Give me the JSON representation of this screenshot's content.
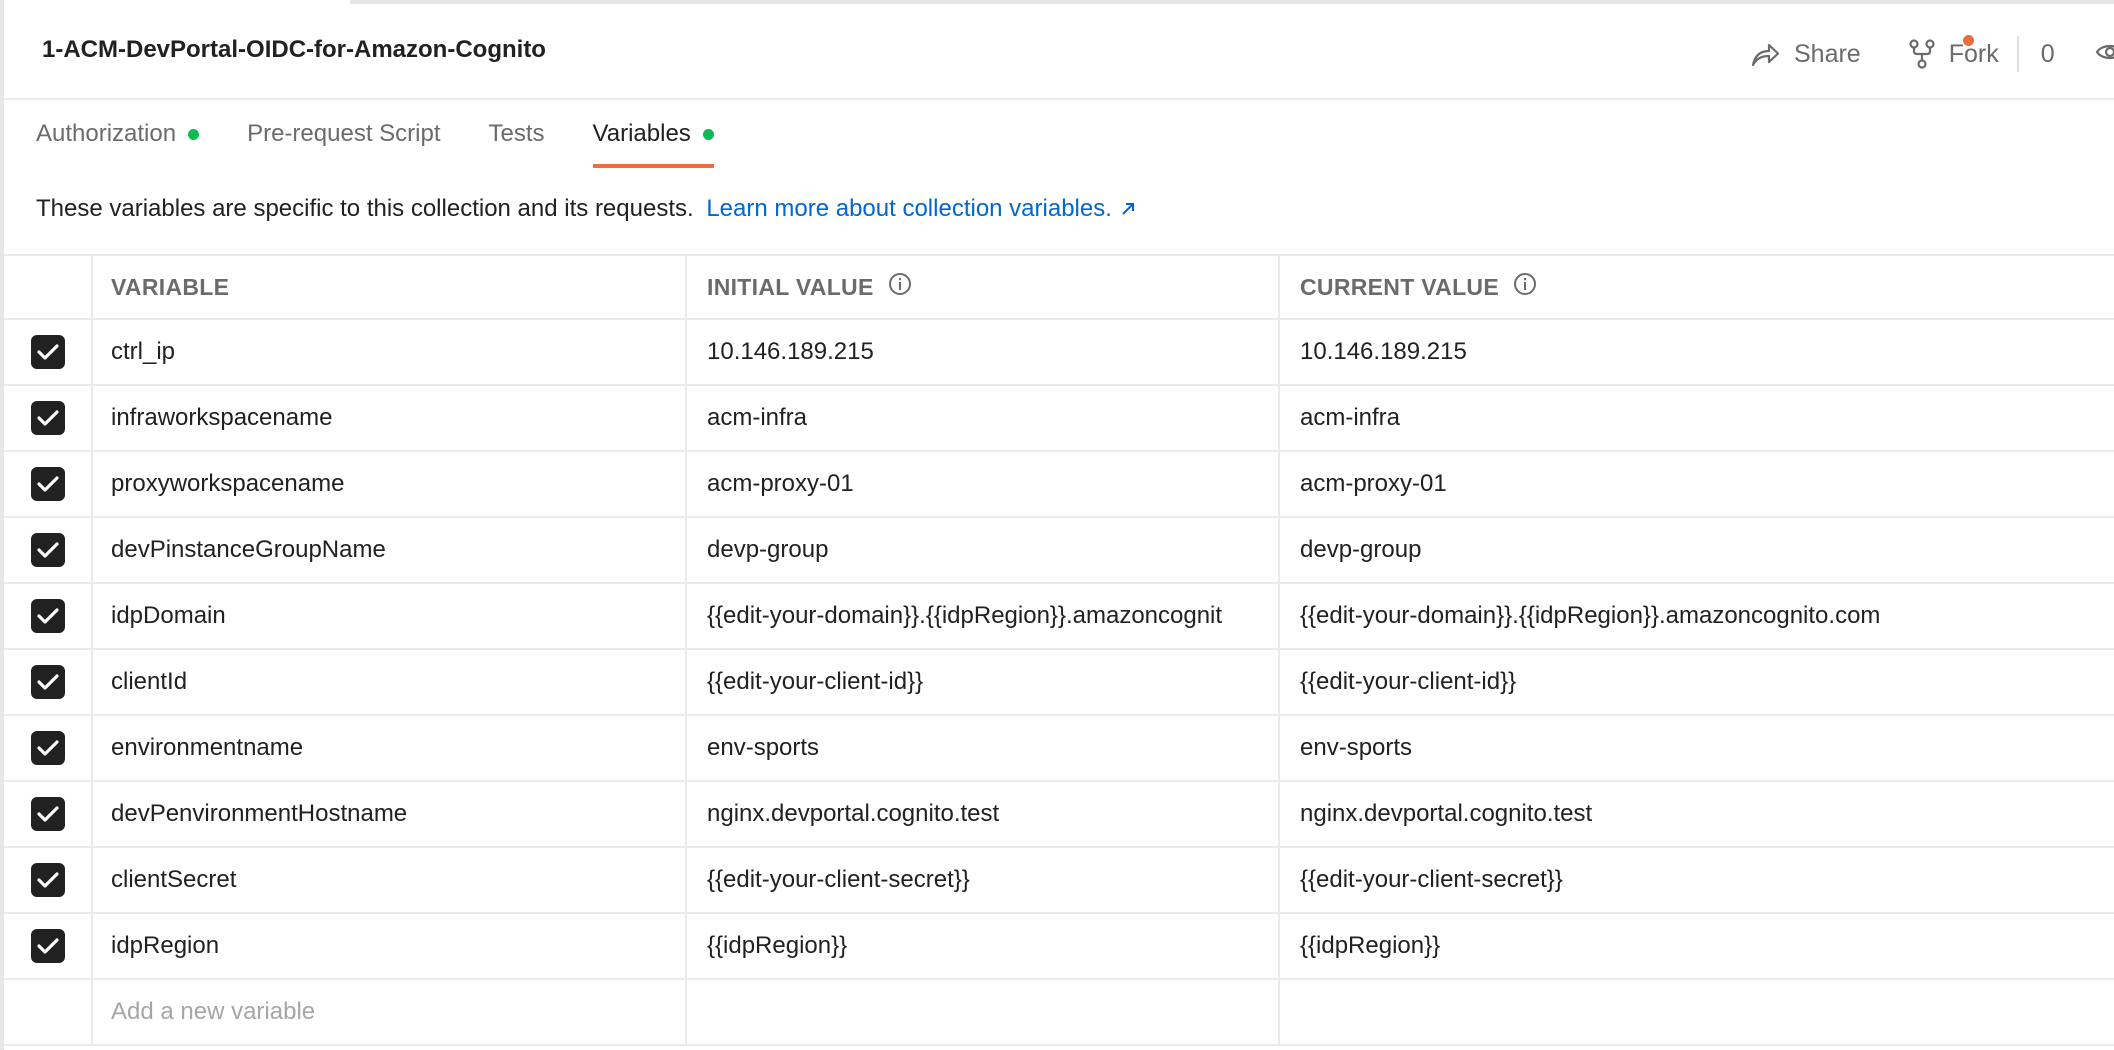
{
  "header": {
    "title": "1-ACM-DevPortal-OIDC-for-Amazon-Cognito",
    "share_label": "Share",
    "fork_label": "Fork",
    "fork_count": "0"
  },
  "tabs": [
    {
      "label": "Authorization",
      "dot": true,
      "active": false
    },
    {
      "label": "Pre-request Script",
      "dot": false,
      "active": false
    },
    {
      "label": "Tests",
      "dot": false,
      "active": false
    },
    {
      "label": "Variables",
      "dot": true,
      "active": true
    }
  ],
  "description": {
    "text": "These variables are specific to this collection and its requests.",
    "link_text": "Learn more about collection variables."
  },
  "table": {
    "headers": {
      "variable": "VARIABLE",
      "initial": "INITIAL VALUE",
      "current": "CURRENT VALUE"
    },
    "rows": [
      {
        "checked": true,
        "variable": "ctrl_ip",
        "initial": "10.146.189.215",
        "current": "10.146.189.215"
      },
      {
        "checked": true,
        "variable": "infraworkspacename",
        "initial": "acm-infra",
        "current": "acm-infra"
      },
      {
        "checked": true,
        "variable": "proxyworkspacename",
        "initial": "acm-proxy-01",
        "current": "acm-proxy-01"
      },
      {
        "checked": true,
        "variable": "devPinstanceGroupName",
        "initial": "devp-group",
        "current": "devp-group"
      },
      {
        "checked": true,
        "variable": "idpDomain",
        "initial": "{{edit-your-domain}}.{{idpRegion}}.amazoncognit",
        "current": "{{edit-your-domain}}.{{idpRegion}}.amazoncognito.com"
      },
      {
        "checked": true,
        "variable": "clientId",
        "initial": "{{edit-your-client-id}}",
        "current": "{{edit-your-client-id}}"
      },
      {
        "checked": true,
        "variable": "environmentname",
        "initial": "env-sports",
        "current": "env-sports"
      },
      {
        "checked": true,
        "variable": "devPenvironmentHostname",
        "initial": "nginx.devportal.cognito.test",
        "current": "nginx.devportal.cognito.test"
      },
      {
        "checked": true,
        "variable": "clientSecret",
        "initial": "{{edit-your-client-secret}}",
        "current": "{{edit-your-client-secret}}"
      },
      {
        "checked": true,
        "variable": "idpRegion",
        "initial": "{{idpRegion}}",
        "current": "{{idpRegion}}"
      }
    ],
    "add_placeholder": "Add a new variable"
  },
  "colors": {
    "accent": "#f26b3a",
    "status_dot": "#0cbb52",
    "link": "#0265d2",
    "checkbox": "#212121"
  },
  "icons": {
    "share": "share-arrow-icon",
    "fork": "fork-icon",
    "watch": "eye-icon",
    "info": "info-icon",
    "external": "external-link-arrow-icon",
    "check": "checkmark-icon"
  }
}
